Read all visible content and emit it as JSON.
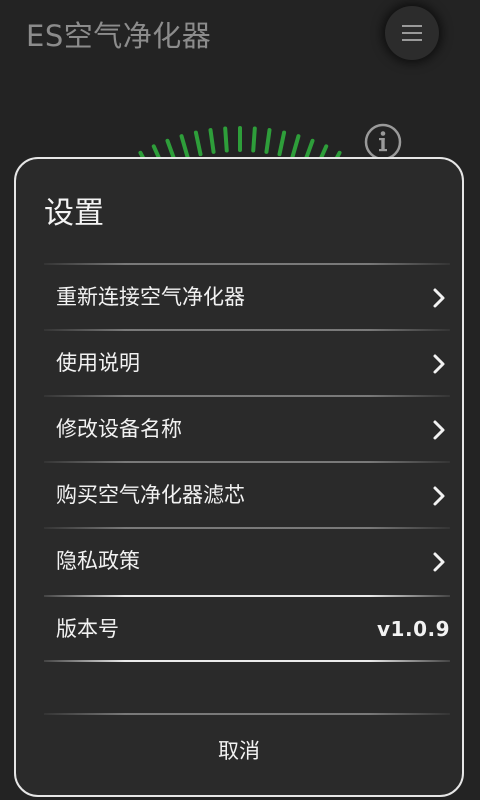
{
  "app": {
    "title": "ES空气净化器",
    "menu_icon": "hamburger-menu-icon",
    "info_icon": "info-icon",
    "gauge_color": "#2e9e3a"
  },
  "dialog": {
    "title": "设置",
    "items": [
      {
        "label": "重新连接空气净化器",
        "icon": "chevron-right-icon"
      },
      {
        "label": "使用说明",
        "icon": "chevron-right-icon"
      },
      {
        "label": "修改设备名称",
        "icon": "chevron-right-icon"
      },
      {
        "label": "购买空气净化器滤芯",
        "icon": "chevron-right-icon"
      },
      {
        "label": "隐私政策",
        "icon": "chevron-right-icon"
      }
    ],
    "version": {
      "label": "版本号",
      "value": "v1.0.9"
    },
    "cancel_label": "取消",
    "colors": {
      "background": "#2a2a2a",
      "border": "#e6e6e6",
      "text": "#f2f2f2"
    }
  }
}
